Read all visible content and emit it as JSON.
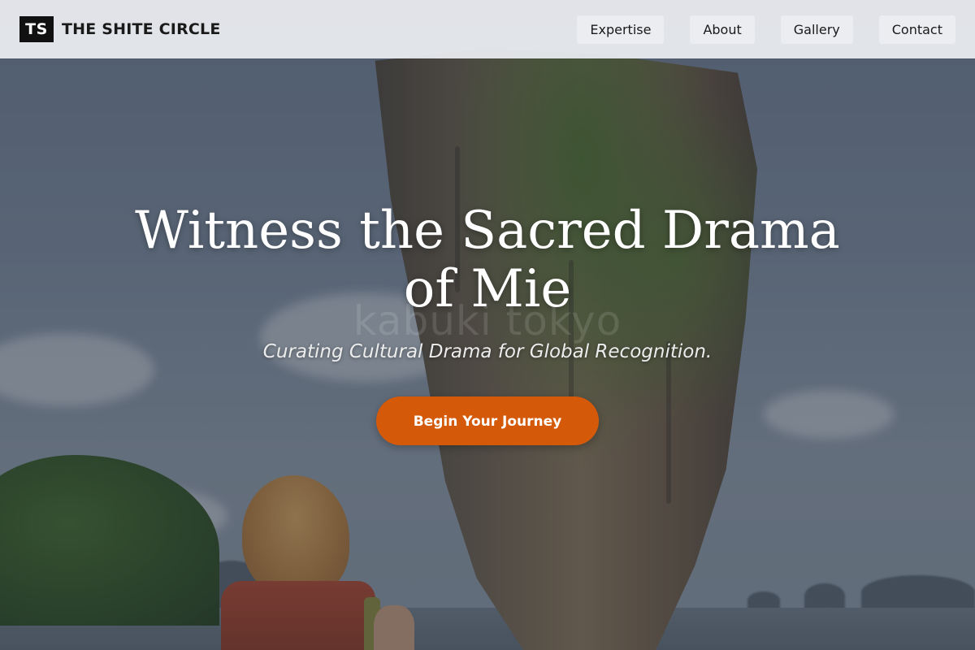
{
  "header": {
    "logo_badge": "TS",
    "brand_name": "THE SHITE CIRCLE",
    "nav": [
      {
        "label": "Expertise"
      },
      {
        "label": "About"
      },
      {
        "label": "Gallery"
      },
      {
        "label": "Contact"
      }
    ]
  },
  "hero": {
    "watermark": "kabuki tokyo",
    "title": "Witness the Sacred Drama of Mie",
    "subtitle": "Curating Cultural Drama for Global Recognition.",
    "cta_label": "Begin Your Journey",
    "background_image": "sea-stack-rock-island-with-traveler"
  },
  "colors": {
    "accent": "#d45a0a",
    "logo_bg": "#111111",
    "header_bg": "#eceef2"
  }
}
